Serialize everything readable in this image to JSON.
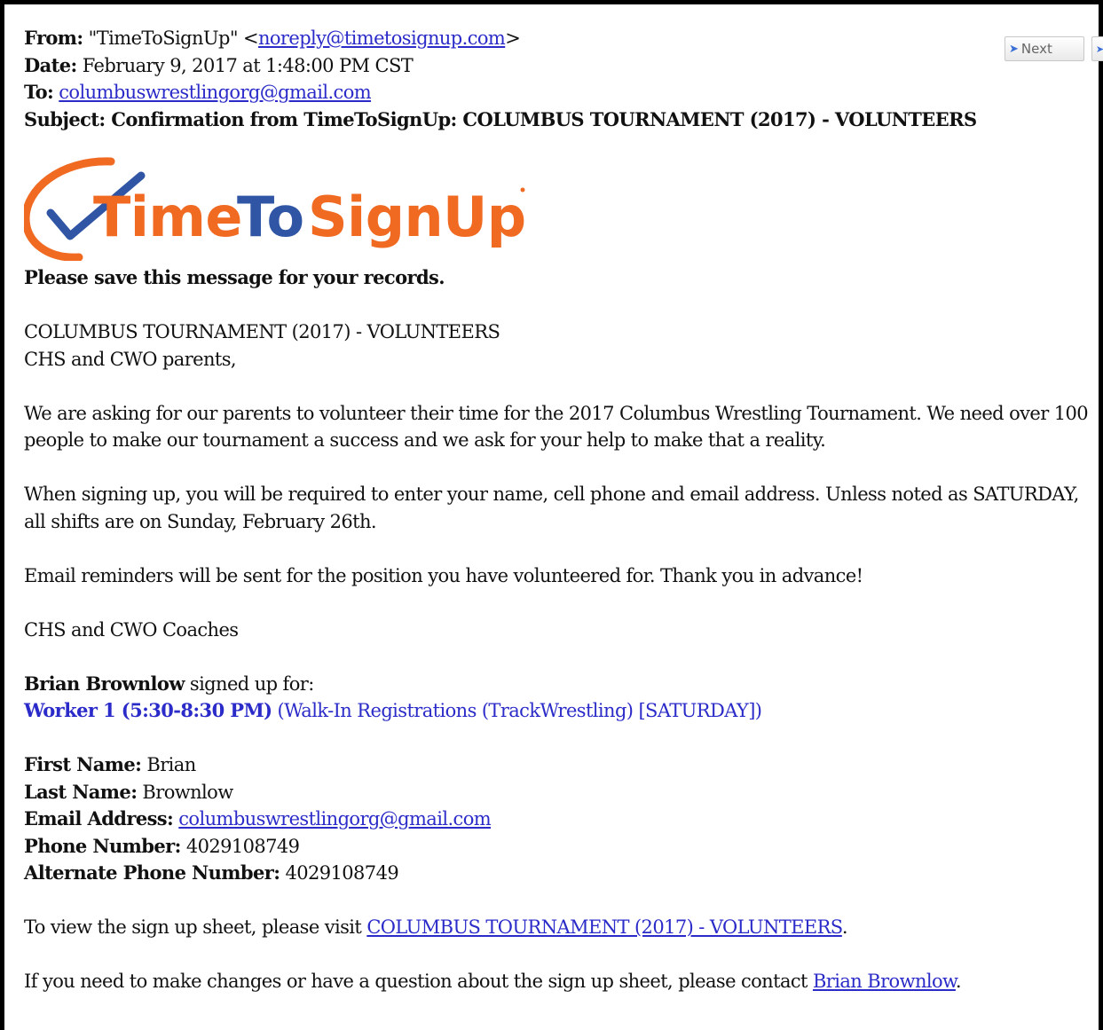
{
  "header": {
    "from_label": "From:",
    "from_name": "\"TimeToSignUp\" <",
    "from_email": "noreply@timetosignup.com",
    "from_close": ">",
    "date_label": "Date:",
    "date_value": "February 9, 2017 at 1:48:00 PM CST",
    "to_label": "To:",
    "to_email": "columbuswrestlingorg@gmail.com",
    "subject_label": "Subject:",
    "subject_value": "Confirmation from TimeToSignUp: COLUMBUS TOURNAMENT (2017) - VOLUNTEERS"
  },
  "toolbar": {
    "next_label": "Next"
  },
  "logo": {
    "text_time": "Time",
    "text_to": "To",
    "text_signup": "SignUp",
    "color_orange": "#f06a22",
    "color_blue": "#2f55a4"
  },
  "body": {
    "save_notice": "Please save this message for your records.",
    "event_title": "COLUMBUS TOURNAMENT (2017) - VOLUNTEERS",
    "greeting": "CHS and CWO parents,",
    "para1": "We are asking for our parents to volunteer their time for the 2017 Columbus Wrestling Tournament. We need over 100 people to make our tournament a success and we ask for your help to make that a reality.",
    "para2": "When signing up, you will be required to enter your name, cell phone and email address. Unless noted as SATURDAY, all shifts are on Sunday, February 26th.",
    "para3": "Email reminders will be sent for the position you have volunteered for. Thank you in advance!",
    "signoff": "CHS and CWO Coaches",
    "signup_name": "Brian Brownlow",
    "signup_text": " signed up for:",
    "slot_name": "Worker 1 (5:30-8:30 PM)",
    "slot_detail": " (Walk-In Registrations (TrackWrestling) [SATURDAY])"
  },
  "details": {
    "first_label": "First Name:",
    "first_value": " Brian",
    "last_label": "Last Name:",
    "last_value": " Brownlow",
    "email_label": "Email Address:",
    "email_value": "columbuswrestlingorg@gmail.com",
    "phone_label": "Phone Number:",
    "phone_value": " 4029108749",
    "alt_label": "Alternate Phone Number:",
    "alt_value": " 4029108749"
  },
  "footer": {
    "view_text": "To view the sign up sheet, please visit ",
    "view_link": "COLUMBUS TOURNAMENT (2017) - VOLUNTEERS",
    "view_end": ".",
    "contact_text": "If you need to make changes or have a question about the sign up sheet, please contact ",
    "contact_link": "Brian Brownlow",
    "contact_end": "."
  }
}
